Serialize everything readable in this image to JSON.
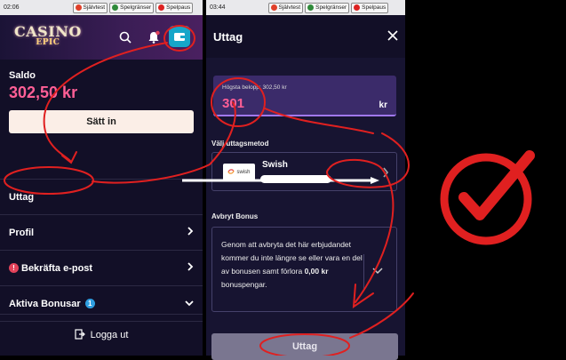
{
  "status_left": {
    "time": "02:06",
    "pills": [
      {
        "label": "Självtest",
        "icon": "speedometer-icon",
        "color": "#e0402a"
      },
      {
        "label": "Spelgränser",
        "icon": "gauge-icon",
        "color": "#2f8a3a"
      },
      {
        "label": "Spelpaus",
        "icon": "pause-icon",
        "color": "#d22"
      }
    ]
  },
  "status_right": {
    "time": "03:44",
    "pills": [
      {
        "label": "Självtest",
        "icon": "speedometer-icon",
        "color": "#e0402a"
      },
      {
        "label": "Spelgränser",
        "icon": "gauge-icon",
        "color": "#2f8a3a"
      },
      {
        "label": "Spelpaus",
        "icon": "pause-icon",
        "color": "#d22"
      }
    ]
  },
  "left": {
    "logo": {
      "line1": "CASINO",
      "line2": "EPIC"
    },
    "balance_label": "Saldo",
    "balance_value": "302,50 kr",
    "deposit_label": "Sätt in",
    "menu": [
      {
        "label": "Uttag",
        "badge": ""
      },
      {
        "label": "Profil",
        "badge": ""
      },
      {
        "label": "Bekräfta e-post",
        "badge": "!"
      },
      {
        "label": "Aktiva Bonusar",
        "badge": "1"
      }
    ],
    "logout_label": "Logga ut"
  },
  "right": {
    "title": "Uttag",
    "amount_caption": "Högsta belopp: 302,50 kr",
    "amount_value": "301",
    "currency": "kr",
    "method_label": "Välj uttagsmetod",
    "method_logo_text": "swish",
    "method_name": "Swish",
    "cancel_bonus_label": "Avbryt Bonus",
    "bonus_text_1": "Genom att avbryta det här erbjudandet kommer du inte längre se eller vara en del av bonusen samt förlora ",
    "bonus_amount": "0,00 kr",
    "bonus_text_2": " bonuspengar.",
    "withdraw_button": "Uttag"
  },
  "colors": {
    "accent_pink": "#ff5f96",
    "annotation_red": "#e02020",
    "bg": "#120f27"
  }
}
